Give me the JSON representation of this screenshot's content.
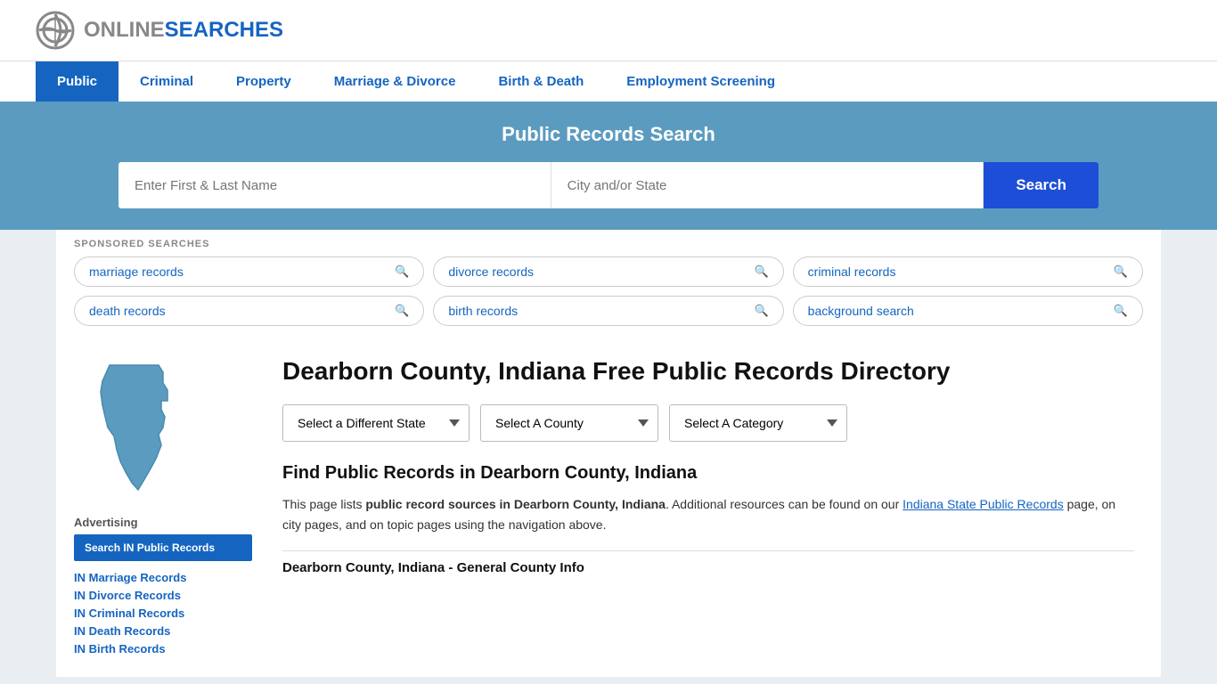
{
  "logo": {
    "text_online": "ONLINE",
    "text_searches": "SEARCHES"
  },
  "nav": {
    "items": [
      {
        "label": "Public",
        "active": true
      },
      {
        "label": "Criminal",
        "active": false
      },
      {
        "label": "Property",
        "active": false
      },
      {
        "label": "Marriage & Divorce",
        "active": false
      },
      {
        "label": "Birth & Death",
        "active": false
      },
      {
        "label": "Employment Screening",
        "active": false
      }
    ]
  },
  "search_banner": {
    "title": "Public Records Search",
    "name_placeholder": "Enter First & Last Name",
    "location_placeholder": "City and/or State",
    "button_label": "Search"
  },
  "sponsored": {
    "label": "SPONSORED SEARCHES",
    "tags": [
      {
        "text": "marriage records"
      },
      {
        "text": "divorce records"
      },
      {
        "text": "criminal records"
      },
      {
        "text": "death records"
      },
      {
        "text": "birth records"
      },
      {
        "text": "background search"
      }
    ]
  },
  "sidebar": {
    "ad_label": "Advertising",
    "ad_button": "Search IN Public Records",
    "links": [
      {
        "text": "IN Marriage Records"
      },
      {
        "text": "IN Divorce Records"
      },
      {
        "text": "IN Criminal Records"
      },
      {
        "text": "IN Death Records"
      },
      {
        "text": "IN Birth Records"
      }
    ]
  },
  "content": {
    "page_title": "Dearborn County, Indiana Free Public Records Directory",
    "dropdowns": {
      "state": "Select a Different State",
      "county": "Select A County",
      "category": "Select A Category"
    },
    "find_title": "Find Public Records in Dearborn County, Indiana",
    "find_desc_1": "This page lists ",
    "find_desc_bold": "public record sources in Dearborn County, Indiana",
    "find_desc_2": ". Additional resources can be found on our ",
    "find_link": "Indiana State Public Records",
    "find_desc_3": " page, on city pages, and on topic pages using the navigation above.",
    "county_info_title": "Dearborn County, Indiana - General County Info"
  }
}
